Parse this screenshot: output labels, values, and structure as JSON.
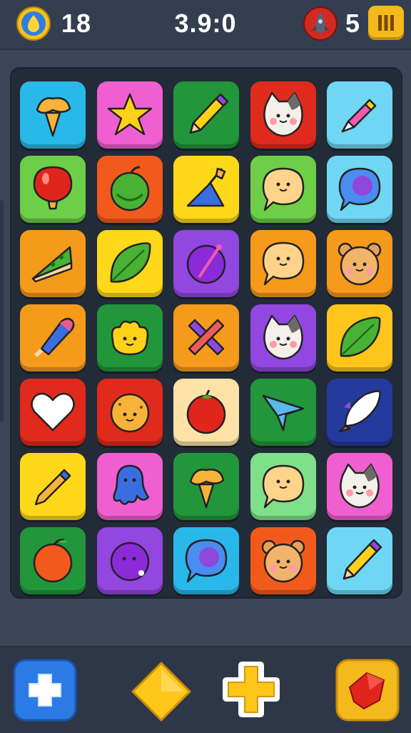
{
  "hud": {
    "coins": "18",
    "timer": "3.9:0",
    "rockets": "5",
    "coin_icon": "coin-icon",
    "rocket_icon": "rocket-icon",
    "pause_icon": "pause-icon"
  },
  "board": {
    "rows": 7,
    "cols": 5,
    "tiles": [
      {
        "icon": "ice-cream-cone",
        "color": "#29b8ea"
      },
      {
        "icon": "star",
        "color": "#f05fd0"
      },
      {
        "icon": "pencil",
        "color": "#22963a"
      },
      {
        "icon": "cat-face",
        "color": "#e02a1c"
      },
      {
        "icon": "crayon",
        "color": "#6fd7f3"
      },
      {
        "icon": "balloon",
        "color": "#6ccf47"
      },
      {
        "icon": "apple",
        "color": "#f25a1c"
      },
      {
        "icon": "trowel",
        "color": "#ffd81a"
      },
      {
        "icon": "speech-bubble-face",
        "color": "#6ccf47"
      },
      {
        "icon": "speech-bubble",
        "color": "#6fd7f3"
      },
      {
        "icon": "pizza-slice",
        "color": "#f59a1b"
      },
      {
        "icon": "leaf",
        "color": "#ffd81a"
      },
      {
        "icon": "purple-ball",
        "color": "#9247e0"
      },
      {
        "icon": "speech-bubble-face",
        "color": "#f59a1b"
      },
      {
        "icon": "bear-face",
        "color": "#f59a1b"
      },
      {
        "icon": "popsicle",
        "color": "#f59a1b"
      },
      {
        "icon": "blob-face",
        "color": "#22963a"
      },
      {
        "icon": "crossed-crayons",
        "color": "#f59a1b"
      },
      {
        "icon": "cat-face",
        "color": "#9247e0"
      },
      {
        "icon": "leaf",
        "color": "#ffc51a"
      },
      {
        "icon": "heart",
        "color": "#e02a1c"
      },
      {
        "icon": "cookie-face",
        "color": "#e02a1c"
      },
      {
        "icon": "tomato",
        "color": "#fde2a8"
      },
      {
        "icon": "paper-plane",
        "color": "#22963a"
      },
      {
        "icon": "rocket",
        "color": "#243a9c"
      },
      {
        "icon": "pen",
        "color": "#ffd81a"
      },
      {
        "icon": "ghost-blob",
        "color": "#f05fd0"
      },
      {
        "icon": "ice-cream-cone",
        "color": "#22963a"
      },
      {
        "icon": "speech-bubble-face",
        "color": "#7fe08a"
      },
      {
        "icon": "cat-face",
        "color": "#f05fd0"
      },
      {
        "icon": "orange",
        "color": "#22963a"
      },
      {
        "icon": "plum",
        "color": "#9247e0"
      },
      {
        "icon": "speech-bubble",
        "color": "#29b8ea"
      },
      {
        "icon": "bear-face",
        "color": "#f25a1c"
      },
      {
        "icon": "pencil",
        "color": "#6fd7f3"
      }
    ]
  },
  "bottom": {
    "buttons": [
      {
        "icon": "plus-icon",
        "color": "#2c7be5"
      },
      {
        "icon": "diamond-icon",
        "color": "#ffc61a"
      },
      {
        "icon": "plus-shape-icon",
        "color": "#ffc61a"
      },
      {
        "icon": "gem-icon",
        "color": "#f4b91c"
      }
    ]
  }
}
